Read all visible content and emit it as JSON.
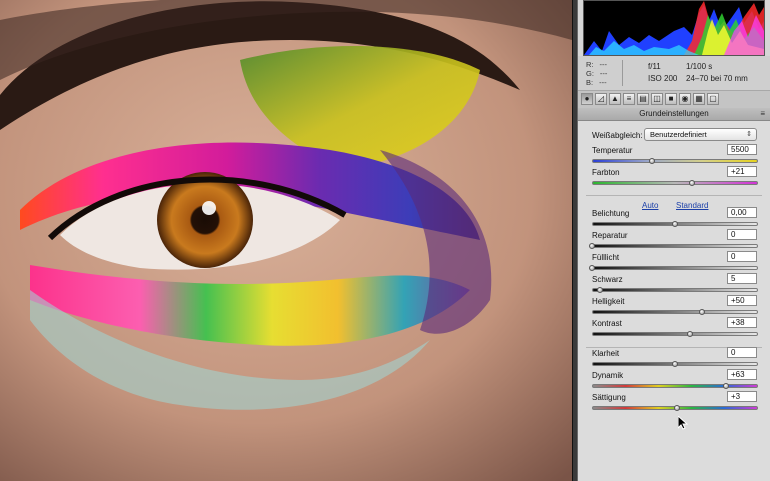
{
  "info": {
    "r_label": "R:",
    "g_label": "G:",
    "b_label": "B:",
    "r_value": "---",
    "g_value": "---",
    "b_value": "---",
    "aperture": "f/11",
    "shutter": "1/100 s",
    "iso": "ISO 200",
    "lens": "24–70 bei 70 mm"
  },
  "tools": [
    "basic-icon",
    "curve-icon",
    "detail-icon",
    "hsl-icon",
    "split-toning-icon",
    "lens-icon",
    "fx-icon",
    "camera-calibration-icon",
    "presets-icon",
    "snapshots-icon"
  ],
  "section_title": "Grundeinstellungen",
  "white_balance": {
    "label": "Weißabgleich:",
    "value": "Benutzerdefiniert"
  },
  "links": {
    "auto": "Auto",
    "standard": "Standard"
  },
  "sliders": [
    {
      "key": "temperatur",
      "label": "Temperatur",
      "value": "5500",
      "level": 0.36,
      "track": "temp"
    },
    {
      "key": "farbton",
      "label": "Farbton",
      "value": "+21",
      "level": 0.6,
      "track": "tint"
    },
    {
      "key": "belichtung",
      "label": "Belichtung",
      "value": "0,00",
      "level": 0.5,
      "track": "grey"
    },
    {
      "key": "reparatur",
      "label": "Reparatur",
      "value": "0",
      "level": 0.0,
      "track": "grey"
    },
    {
      "key": "fuelllicht",
      "label": "Fülllicht",
      "value": "0",
      "level": 0.0,
      "track": "grey"
    },
    {
      "key": "schwarz",
      "label": "Schwarz",
      "value": "5",
      "level": 0.05,
      "track": "grey"
    },
    {
      "key": "helligkeit",
      "label": "Helligkeit",
      "value": "+50",
      "level": 0.66,
      "track": "grey"
    },
    {
      "key": "kontrast",
      "label": "Kontrast",
      "value": "+38",
      "level": 0.59,
      "track": "grey"
    },
    {
      "key": "klarheit",
      "label": "Klarheit",
      "value": "0",
      "level": 0.5,
      "track": "grey"
    },
    {
      "key": "dynamik",
      "label": "Dynamik",
      "value": "+63",
      "level": 0.81,
      "track": "sat"
    },
    {
      "key": "saettigung",
      "label": "Sättigung",
      "value": "+3",
      "level": 0.51,
      "track": "sat"
    }
  ],
  "colors": {
    "panel_bg": "#dcdcdc",
    "link": "#1b3fa8",
    "histogram_bg": "#000000"
  }
}
